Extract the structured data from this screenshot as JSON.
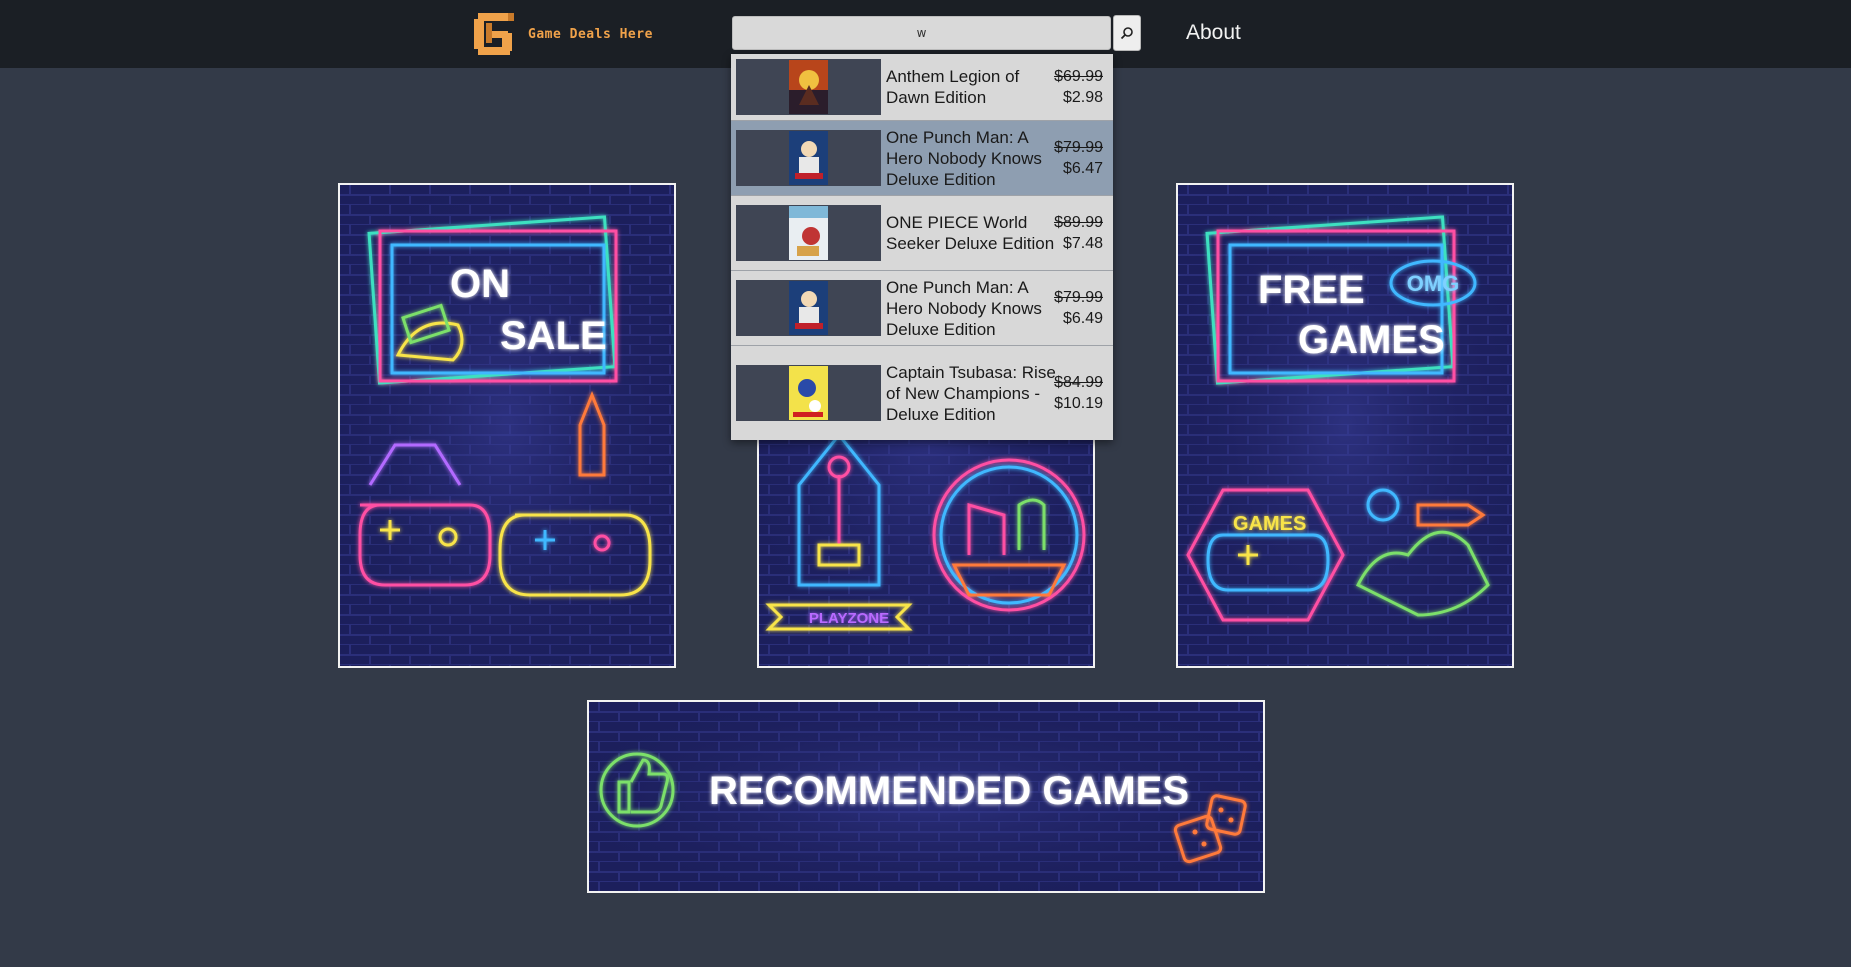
{
  "header": {
    "logo_text": "Game Deals Here",
    "search_value": "w",
    "search_icon": "search-icon",
    "nav_about": "About"
  },
  "dropdown": [
    {
      "title": "Anthem Legion of Dawn Edition",
      "old_price": "$69.99",
      "price": "$2.98"
    },
    {
      "title": "One Punch Man: A Hero Nobody Knows Deluxe Edition",
      "old_price": "$79.99",
      "price": "$6.47"
    },
    {
      "title": "ONE PIECE World Seeker Deluxe Edition",
      "old_price": "$89.99",
      "price": "$7.48"
    },
    {
      "title": "One Punch Man: A Hero Nobody Knows Deluxe Edition",
      "old_price": "$79.99",
      "price": "$6.49"
    },
    {
      "title": "Captain Tsubasa: Rise of New Champions - Deluxe Edition",
      "old_price": "$84.99",
      "price": "$10.19"
    }
  ],
  "banners": {
    "on_sale": {
      "line1": "ON",
      "line2": "SALE"
    },
    "playzone": {
      "label": "PLAYZONE"
    },
    "free_games": {
      "line1": "FREE",
      "line2": "GAMES",
      "badge": "OMG",
      "pad_label": "GAMES"
    },
    "recommended": {
      "label": "RECOMMENDED GAMES"
    }
  },
  "colors": {
    "background": "#333a48",
    "header": "#1b1f25",
    "accent_orange": "#f0a24a",
    "dropdown": "#d8d8d8",
    "dropdown_highlight": "#8e9eb1",
    "banner_wall": "#1c1f5c"
  }
}
